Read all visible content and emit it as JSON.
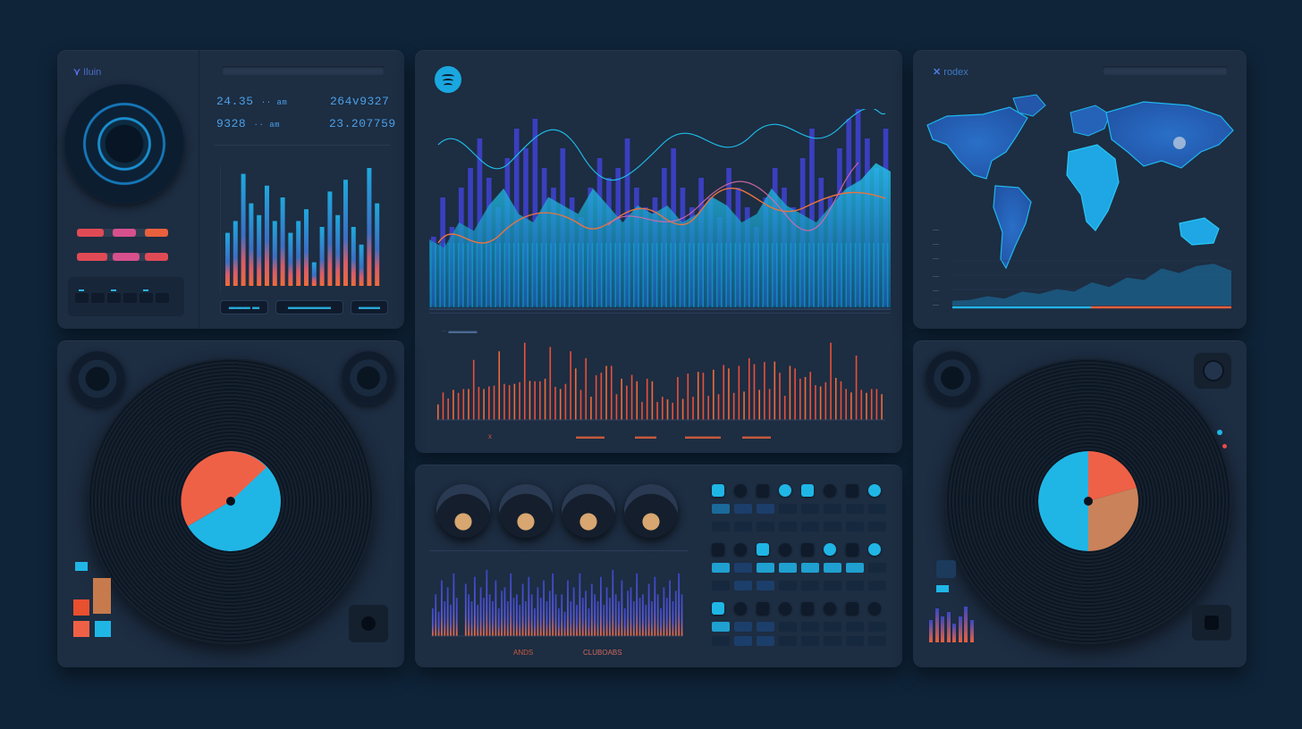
{
  "colors": {
    "bg": "#0f2439",
    "panel": "#1d2d42",
    "blue": "#3a47c4",
    "cyan": "#19b0e6",
    "orange": "#e85d3c",
    "red": "#e84a4a",
    "pink": "#d6508c",
    "spotify": "#1aa7e0"
  },
  "left_top": {
    "brand": "Iluin",
    "stats": [
      "24.35",
      "264v9327",
      "9328",
      "23.207759"
    ],
    "stat_suffix_1": "·· am",
    "stat_suffix_2": "·· am",
    "chart_pills": [
      "▬▬▬ ▬",
      "▬▬▬▬▬▬",
      "▬▬▬"
    ],
    "faders": [
      {
        "level": 0.45
      },
      {
        "level": 0.6
      },
      {
        "level": 0.5
      },
      {
        "level": 0.5
      }
    ]
  },
  "center_top": {
    "logo": "spotify-icon",
    "caption": "·· ▬▬▬▬",
    "x_labels": [
      "x",
      "▬▬▬▬",
      "▬▬▬",
      "▬▬▬▬▬",
      "▬▬▬▬"
    ],
    "bar_values": [
      0.35,
      0.55,
      0.4,
      0.6,
      0.7,
      0.85,
      0.65,
      0.5,
      0.75,
      0.9,
      0.8,
      0.95,
      0.7,
      0.6,
      0.8,
      0.55,
      0.45,
      0.6,
      0.75,
      0.65,
      0.7,
      0.85,
      0.6,
      0.5,
      0.55,
      0.7,
      0.8,
      0.6,
      0.5,
      0.65,
      0.55,
      0.45,
      0.7,
      0.6,
      0.5,
      0.4,
      0.55,
      0.7,
      0.6,
      0.5,
      0.75,
      0.9,
      0.65,
      0.55,
      0.8,
      0.95,
      1.0,
      0.85,
      0.7,
      0.9
    ],
    "area_values": [
      0.4,
      0.35,
      0.5,
      0.45,
      0.6,
      0.7,
      0.55,
      0.5,
      0.65,
      0.6,
      0.55,
      0.7,
      0.6,
      0.5,
      0.6,
      0.55,
      0.6,
      0.5,
      0.55,
      0.65,
      0.6,
      0.5,
      0.55,
      0.7,
      0.6,
      0.55,
      0.5,
      0.6,
      0.7,
      0.75,
      0.85,
      0.8
    ],
    "orange_values": [
      0.3,
      0.4,
      0.25,
      0.5,
      0.35,
      0.6,
      0.45,
      0.7,
      0.55,
      0.4,
      0.65,
      0.5,
      0.8,
      0.6,
      0.45,
      0.7,
      0.55,
      0.9,
      0.65,
      0.5,
      0.75,
      0.6,
      0.85,
      0.55,
      0.4,
      0.7,
      1.0,
      0.6,
      0.5,
      0.8,
      0.45,
      0.65,
      0.55,
      0.9,
      0.7,
      0.5,
      0.6,
      0.4,
      0.75,
      0.5,
      0.35,
      0.6,
      0.45,
      0.3
    ]
  },
  "right_top": {
    "brand": "rodex",
    "axis_ticks": [
      "—",
      "—",
      "—",
      "—",
      "—",
      "—"
    ],
    "area_values": [
      0.1,
      0.12,
      0.2,
      0.15,
      0.3,
      0.25,
      0.35,
      0.3,
      0.5,
      0.4,
      0.6,
      0.55,
      0.8,
      0.7,
      0.85,
      0.9,
      0.75
    ]
  },
  "center_bottom": {
    "captions": [
      "ANDS",
      "CLUBOABS"
    ],
    "bar_values": [
      0.4,
      0.6,
      0.35,
      0.8,
      0.5,
      0.7,
      0.45,
      0.9,
      0.55,
      0.65,
      0.4,
      0.75,
      0.6,
      0.5,
      0.85,
      0.45,
      0.7,
      0.55,
      0.95,
      0.6,
      0.5,
      0.8,
      0.4,
      0.65,
      0.7,
      0.5,
      0.9,
      0.55,
      0.6,
      0.45,
      0.75,
      0.5,
      0.85,
      0.6,
      0.4,
      0.7,
      0.55,
      0.8,
      0.5,
      0.65,
      0.9,
      0.6
    ],
    "knob_count": 4
  },
  "turntables": {
    "left_label_colors": [
      "#ef6146",
      "#1fb6e6"
    ],
    "right_label_colors": [
      "#ef6146",
      "#c9825a",
      "#1fb6e6"
    ],
    "left_level_values": [
      0.6,
      0.9,
      0.7,
      0.8,
      0.5
    ]
  }
}
